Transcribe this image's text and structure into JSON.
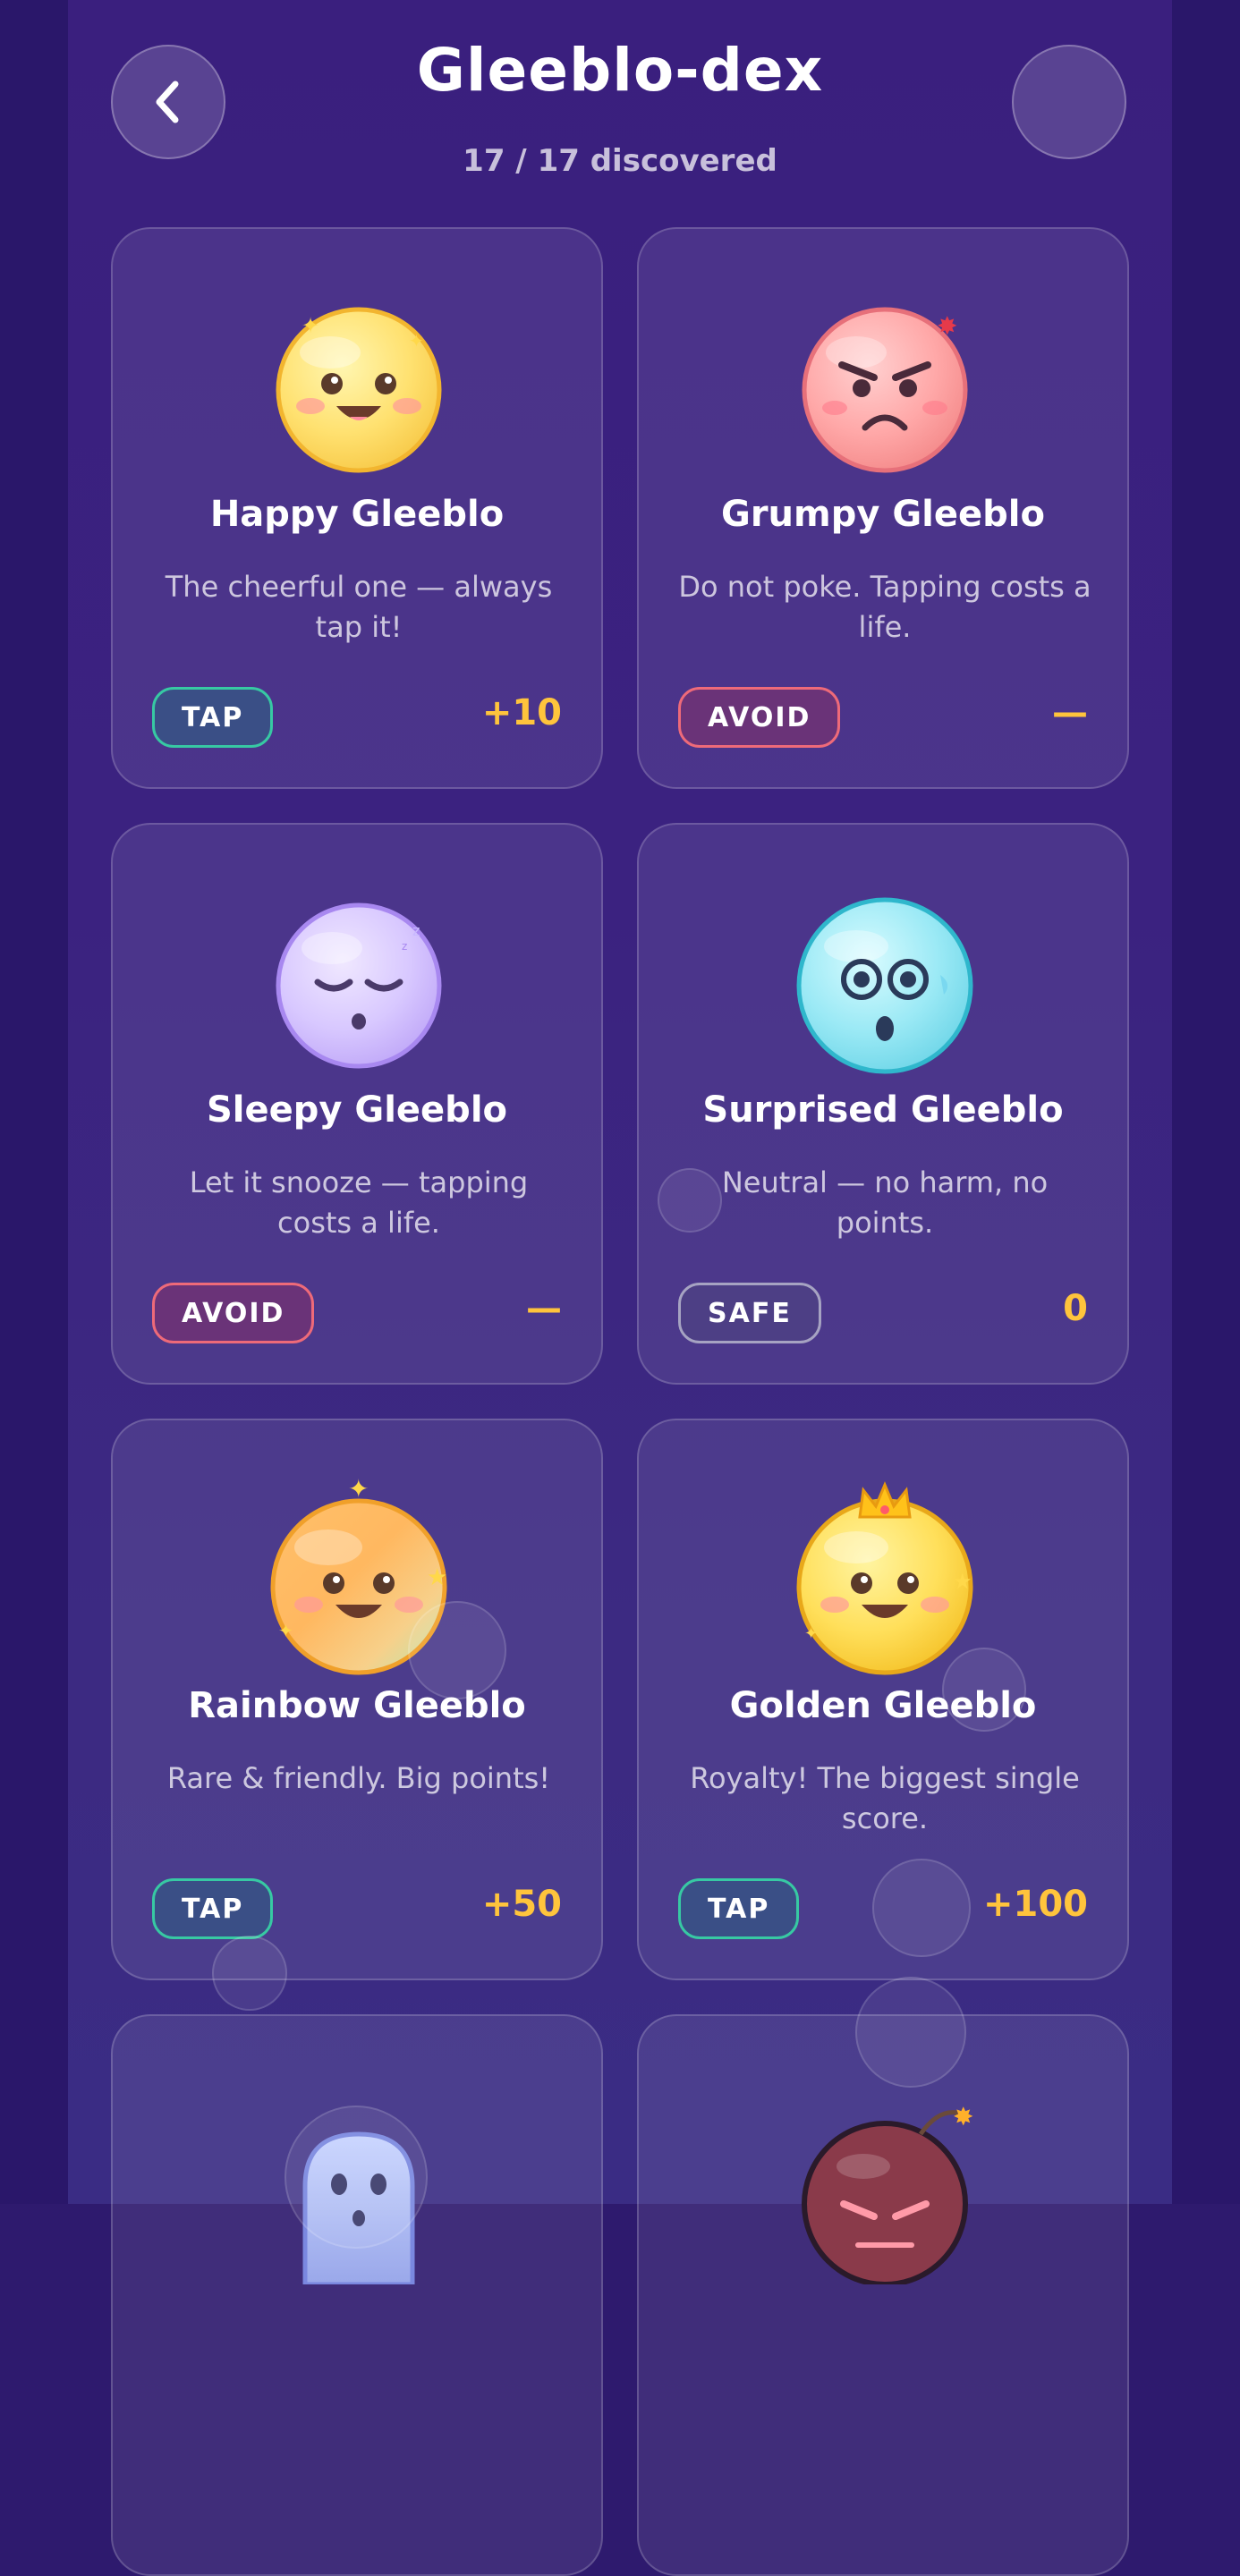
{
  "header": {
    "title": "Gleeblo-dex",
    "subtitle": "17 / 17 discovered",
    "back_icon": "chevron-left-icon",
    "menu_icon": ""
  },
  "colors": {
    "background": "#3a1f7e",
    "card": "rgba(255,255,255,0.085)",
    "points": "#ffc43c",
    "tap_border": "#37c9a3",
    "avoid_border": "#ee6a79",
    "safe_border": "#a6a3c2"
  },
  "cards": [
    {
      "name": "Happy Gleeblo",
      "desc": "The cheerful one — always tap it!",
      "badge": "TAP",
      "points": "+10",
      "icon": "happy-face-icon"
    },
    {
      "name": "Grumpy Gleeblo",
      "desc": "Do not poke. Tapping costs a life.",
      "badge": "AVOID",
      "points": "—",
      "icon": "angry-face-icon"
    },
    {
      "name": "Sleepy Gleeblo",
      "desc": "Let it snooze — tapping costs a life.",
      "badge": "AVOID",
      "points": "—",
      "icon": "sleepy-face-icon"
    },
    {
      "name": "Surprised Gleeblo",
      "desc": "Neutral — no harm, no points.",
      "badge": "SAFE",
      "points": "0",
      "icon": "surprised-face-icon"
    },
    {
      "name": "Rainbow Gleeblo",
      "desc": "Rare & friendly. Big points!",
      "badge": "TAP",
      "points": "+50",
      "icon": "rainbow-face-icon"
    },
    {
      "name": "Golden Gleeblo",
      "desc": "Royalty! The biggest single score.",
      "badge": "TAP",
      "points": "+100",
      "icon": "crowned-face-icon"
    },
    {
      "name": "",
      "desc": "",
      "badge": "",
      "points": "",
      "icon": "ghost-icon"
    },
    {
      "name": "",
      "desc": "",
      "badge": "",
      "points": "",
      "icon": "bomb-face-icon"
    }
  ]
}
